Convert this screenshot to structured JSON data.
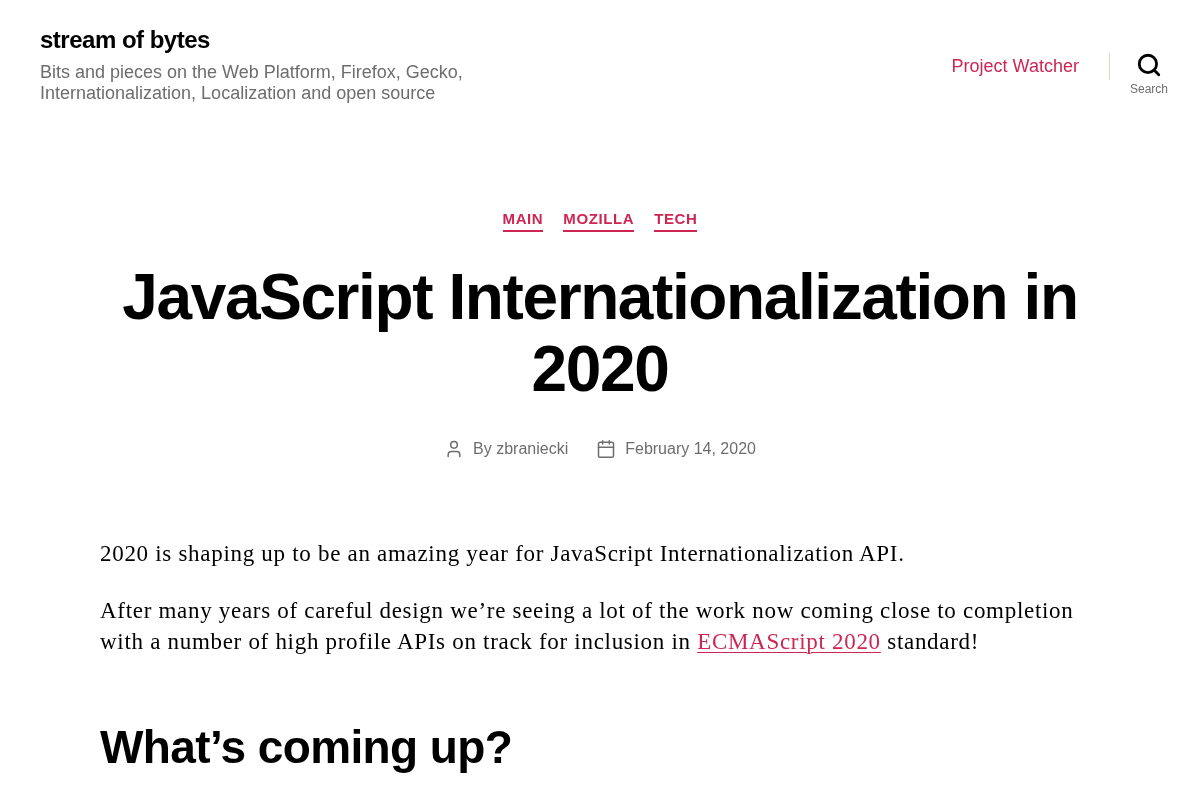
{
  "site": {
    "title": "stream of bytes",
    "description": "Bits and pieces on the Web Platform, Firefox, Gecko, Internationalization, Localization and open source"
  },
  "nav": {
    "links": [
      {
        "label": "Project Watcher"
      }
    ],
    "search": {
      "label": "Search"
    }
  },
  "post": {
    "categories": [
      "MAIN",
      "MOZILLA",
      "TECH"
    ],
    "title": "JavaScript Internationalization in 2020",
    "meta": {
      "author": "By zbraniecki",
      "date": "February 14, 2020"
    },
    "content": [
      {
        "kind": "paragraph",
        "segments": [
          {
            "kind": "text",
            "text": "2020 is shaping up to be an amazing year for JavaScript Internationalization API."
          }
        ]
      },
      {
        "kind": "paragraph",
        "segments": [
          {
            "kind": "text",
            "text": "After many years of careful design we’re seeing a lot of the work now coming close to completion with a number of high profile APIs on track for inclusion in "
          },
          {
            "kind": "link",
            "text": "ECMAScript 2020"
          },
          {
            "kind": "text",
            "text": " standard!"
          }
        ]
      },
      {
        "kind": "heading",
        "text": "What’s coming up?"
      }
    ]
  }
}
